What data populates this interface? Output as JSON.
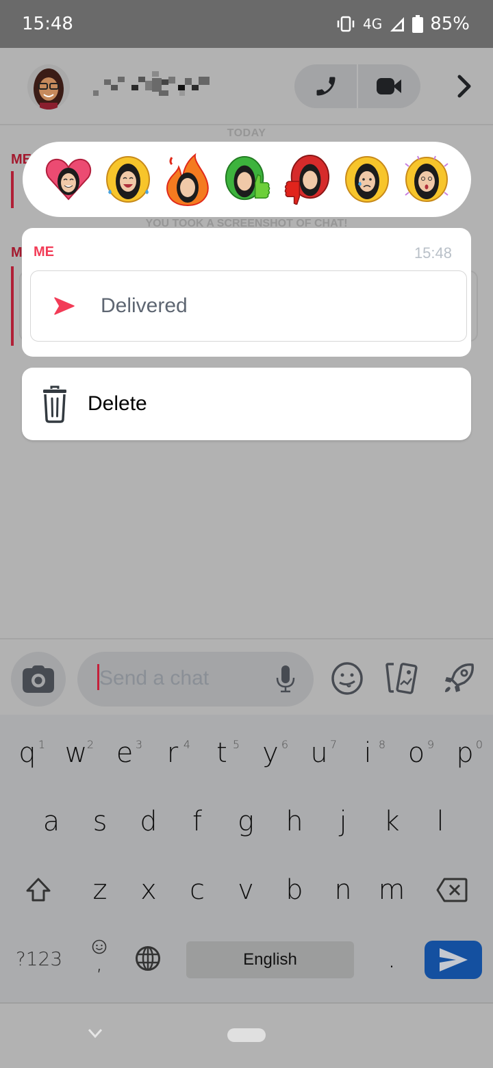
{
  "status_bar": {
    "time": "15:48",
    "network": "4G",
    "battery": "85%",
    "icons": [
      "vibrate-icon",
      "signal-icon",
      "battery-icon"
    ]
  },
  "header": {
    "contact_name": "[pixelated]",
    "icons": [
      "avatar",
      "phone-icon",
      "video-camera-icon",
      "chevron-right-icon"
    ]
  },
  "chat": {
    "date_label": "TODAY",
    "screenshot_notice": "YOU TOOK A SCREENSHOT OF CHAT!",
    "bg_sender_1": "ME",
    "bg_sender_2": "ME"
  },
  "reactions": {
    "items": [
      {
        "name": "heart-reaction",
        "label": "Love"
      },
      {
        "name": "laughing-tears-reaction",
        "label": "Laughing"
      },
      {
        "name": "fire-reaction",
        "label": "Fire"
      },
      {
        "name": "thumbs-up-reaction",
        "label": "Thumbs up"
      },
      {
        "name": "thumbs-down-reaction",
        "label": "Thumbs down"
      },
      {
        "name": "crying-reaction",
        "label": "Sad"
      },
      {
        "name": "shocked-reaction",
        "label": "Shocked"
      }
    ]
  },
  "message_card": {
    "sender": "ME",
    "timestamp": "15:48",
    "status": "Delivered",
    "status_icon": "delivered-arrow-icon"
  },
  "actions": {
    "delete_label": "Delete"
  },
  "compose": {
    "placeholder": "Send a chat",
    "icons": [
      "camera-icon",
      "microphone-icon",
      "emoji-icon",
      "stickers-icon",
      "rocket-icon"
    ]
  },
  "keyboard": {
    "row1": [
      {
        "key": "q",
        "hint": "1"
      },
      {
        "key": "w",
        "hint": "2"
      },
      {
        "key": "e",
        "hint": "3"
      },
      {
        "key": "r",
        "hint": "4"
      },
      {
        "key": "t",
        "hint": "5"
      },
      {
        "key": "y",
        "hint": "6"
      },
      {
        "key": "u",
        "hint": "7"
      },
      {
        "key": "i",
        "hint": "8"
      },
      {
        "key": "o",
        "hint": "9"
      },
      {
        "key": "p",
        "hint": "0"
      }
    ],
    "row2": [
      "a",
      "s",
      "d",
      "f",
      "g",
      "h",
      "j",
      "k",
      "l"
    ],
    "row3": [
      "z",
      "x",
      "c",
      "v",
      "b",
      "n",
      "m"
    ],
    "symbols_label": "?123",
    "comma": ",",
    "space_label": "English",
    "period": "."
  },
  "colors": {
    "accent_red": "#f23c57",
    "keyboard_send_blue": "#1450a0",
    "timestamp_gray": "#b9c0c8"
  }
}
